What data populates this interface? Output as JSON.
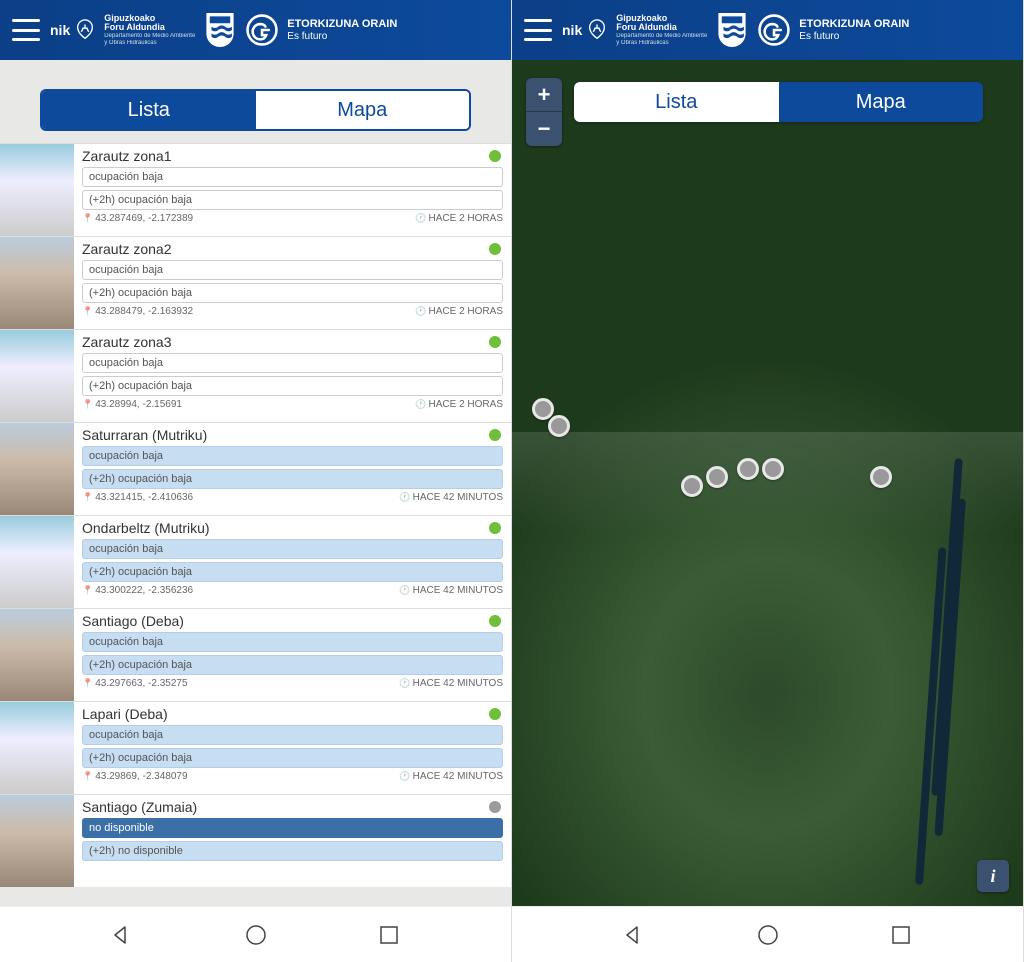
{
  "header": {
    "brand1": "nik",
    "brand2_line1": "Gipuzkoako",
    "brand2_line2": "Foru Aldundia",
    "brand2_line3": "Departamento de Medio Ambiente",
    "brand2_line4": "y Obras Hidráulicas",
    "brand3_line1": "ETORKIZUNA ORAIN",
    "brand3_line2": "Es futuro"
  },
  "tabs": {
    "lista": "Lista",
    "mapa": "Mapa"
  },
  "zoom": {
    "in": "+",
    "out": "−"
  },
  "info": "i",
  "list": [
    {
      "title": "Zarautz zona1",
      "occ": "ocupación baja",
      "fore": "(+2h) ocupación baja",
      "coords": "43.287469, -2.172389",
      "time": "HACE 2 HORAS",
      "status": "green",
      "style": "plain"
    },
    {
      "title": "Zarautz zona2",
      "occ": "ocupación baja",
      "fore": "(+2h) ocupación baja",
      "coords": "43.288479, -2.163932",
      "time": "HACE 2 HORAS",
      "status": "green",
      "style": "plain"
    },
    {
      "title": "Zarautz zona3",
      "occ": "ocupación baja",
      "fore": "(+2h) ocupación baja",
      "coords": "43.28994, -2.15691",
      "time": "HACE 2 HORAS",
      "status": "green",
      "style": "plain"
    },
    {
      "title": "Saturraran (Mutriku)",
      "occ": "ocupación baja",
      "fore": "(+2h) ocupación baja",
      "coords": "43.321415, -2.410636",
      "time": "HACE 42 MINUTOS",
      "status": "green",
      "style": "blue"
    },
    {
      "title": "Ondarbeltz (Mutriku)",
      "occ": "ocupación baja",
      "fore": "(+2h) ocupación baja",
      "coords": "43.300222, -2.356236",
      "time": "HACE 42 MINUTOS",
      "status": "green",
      "style": "blue"
    },
    {
      "title": "Santiago (Deba)",
      "occ": "ocupación baja",
      "fore": "(+2h) ocupación baja",
      "coords": "43.297663, -2.35275",
      "time": "HACE 42 MINUTOS",
      "status": "green",
      "style": "blue"
    },
    {
      "title": "Lapari (Deba)",
      "occ": "ocupación baja",
      "fore": "(+2h) ocupación baja",
      "coords": "43.29869, -2.348079",
      "time": "HACE 42 MINUTOS",
      "status": "green",
      "style": "blue"
    },
    {
      "title": "Santiago (Zumaia)",
      "occ": "no disponible",
      "fore": "(+2h) no disponible",
      "coords": "",
      "time": "",
      "status": "gray",
      "style": "blue2"
    }
  ],
  "markers": [
    {
      "x": 4,
      "y": 40
    },
    {
      "x": 7,
      "y": 42
    },
    {
      "x": 33,
      "y": 49
    },
    {
      "x": 38,
      "y": 48
    },
    {
      "x": 44,
      "y": 47
    },
    {
      "x": 49,
      "y": 47
    },
    {
      "x": 70,
      "y": 48
    }
  ]
}
